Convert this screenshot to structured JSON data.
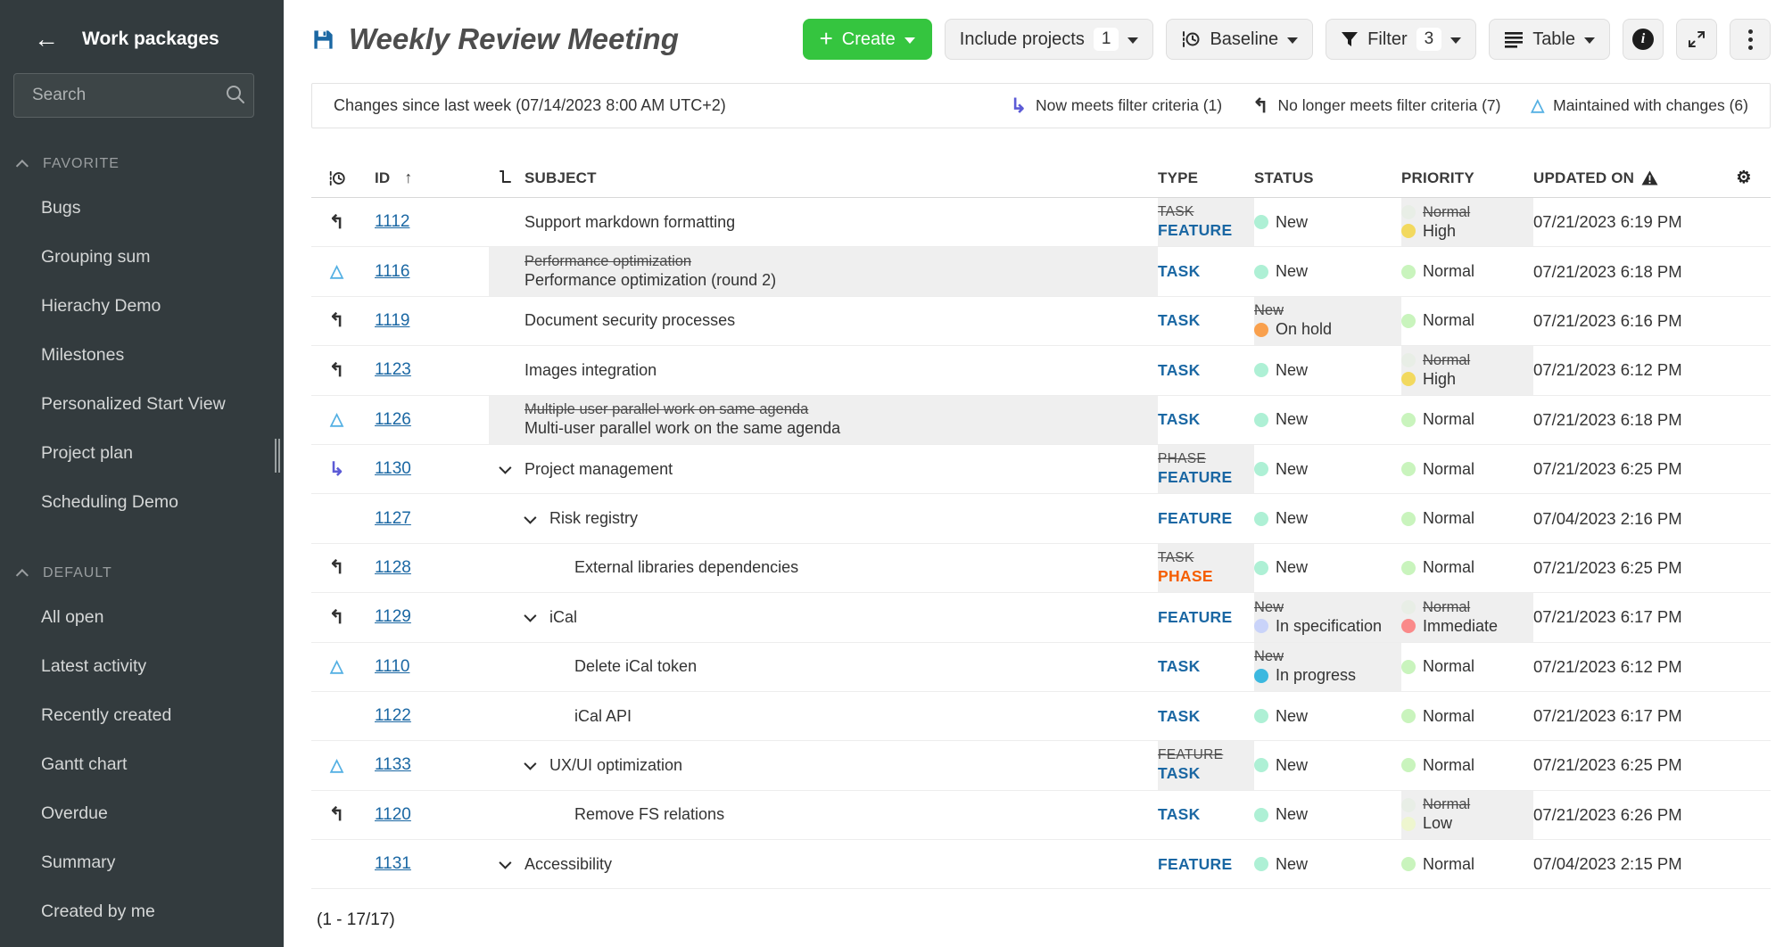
{
  "colors": {
    "accent_green": "#35c53f",
    "link_blue": "#1a67a3",
    "phase_orange": "#f55e00",
    "now_meets_purple": "#5c5bd6",
    "no_longer_meets_dark": "#333333",
    "maintained_blue": "#54b0e3",
    "changed_cell_bg": "#efefef",
    "sidebar_bg": "#333b3e"
  },
  "sidebar": {
    "title": "Work packages",
    "search_placeholder": "Search",
    "sections": [
      {
        "label": "FAVORITE",
        "items": [
          "Bugs",
          "Grouping sum",
          "Hierachy Demo",
          "Milestones",
          "Personalized Start View",
          "Project plan",
          "Scheduling Demo"
        ]
      },
      {
        "label": "DEFAULT",
        "items": [
          "All open",
          "Latest activity",
          "Recently created",
          "Gantt chart",
          "Overdue",
          "Summary",
          "Created by me"
        ]
      }
    ]
  },
  "toolbar": {
    "page_title": "Weekly Review Meeting",
    "create_label": "Create",
    "include_projects_label": "Include projects",
    "include_projects_count": "1",
    "baseline_label": "Baseline",
    "filter_label": "Filter",
    "filter_count": "3",
    "table_label": "Table"
  },
  "changes_bar": {
    "label": "Changes since last week (07/14/2023 8:00 AM UTC+2)",
    "legend": [
      {
        "icon": "now-meets-arrow-icon",
        "label": "Now meets filter criteria (1)",
        "color": "#5c5bd6"
      },
      {
        "icon": "no-longer-meets-arrow-icon",
        "label": "No longer meets filter criteria (7)",
        "color": "#333333"
      },
      {
        "icon": "maintained-triangle-icon",
        "label": "Maintained with changes (6)",
        "color": "#54b0e3"
      }
    ]
  },
  "table": {
    "columns": [
      "ID",
      "SUBJECT",
      "TYPE",
      "STATUS",
      "PRIORITY",
      "UPDATED ON"
    ],
    "rows": [
      {
        "id": "1112",
        "row_icon": "no-longer-meets",
        "indent": 0,
        "chevron": false,
        "subject": {
          "old": null,
          "text": "Support markdown formatting",
          "changed": false
        },
        "type": {
          "old": "TASK",
          "text": "FEATURE",
          "color": "#1a67a3",
          "changed": true
        },
        "status": {
          "old": null,
          "text": "New",
          "dot": "#aef0d5",
          "changed": false
        },
        "priority": {
          "old": "Normal",
          "old_dot": "#c9f4bd",
          "text": "High",
          "dot": "#f2d95f",
          "changed": true
        },
        "updated": "07/21/2023 6:19 PM"
      },
      {
        "id": "1116",
        "row_icon": "maintained",
        "indent": 0,
        "chevron": false,
        "subject": {
          "old": "Performance optimization",
          "text": "Performance optimization (round 2)",
          "changed": true
        },
        "type": {
          "old": null,
          "text": "TASK",
          "color": "#1a67a3",
          "changed": false
        },
        "status": {
          "old": null,
          "text": "New",
          "dot": "#aef0d5",
          "changed": false
        },
        "priority": {
          "old": null,
          "old_dot": null,
          "text": "Normal",
          "dot": "#c9f4bd",
          "changed": false
        },
        "updated": "07/21/2023 6:18 PM"
      },
      {
        "id": "1119",
        "row_icon": "no-longer-meets",
        "indent": 0,
        "chevron": false,
        "subject": {
          "old": null,
          "text": "Document security processes",
          "changed": false
        },
        "type": {
          "old": null,
          "text": "TASK",
          "color": "#1a67a3",
          "changed": false
        },
        "status": {
          "old": "New",
          "text": "On hold",
          "dot": "#f9a04d",
          "changed": true
        },
        "priority": {
          "old": null,
          "old_dot": null,
          "text": "Normal",
          "dot": "#c9f4bd",
          "changed": false
        },
        "updated": "07/21/2023 6:16 PM"
      },
      {
        "id": "1123",
        "row_icon": "no-longer-meets",
        "indent": 0,
        "chevron": false,
        "subject": {
          "old": null,
          "text": "Images integration",
          "changed": false
        },
        "type": {
          "old": null,
          "text": "TASK",
          "color": "#1a67a3",
          "changed": false
        },
        "status": {
          "old": null,
          "text": "New",
          "dot": "#aef0d5",
          "changed": false
        },
        "priority": {
          "old": "Normal",
          "old_dot": "#c9f4bd",
          "text": "High",
          "dot": "#f2d95f",
          "changed": true
        },
        "updated": "07/21/2023 6:12 PM"
      },
      {
        "id": "1126",
        "row_icon": "maintained",
        "indent": 0,
        "chevron": false,
        "subject": {
          "old": "Multiple user parallel work on same agenda",
          "text": "Multi-user parallel work on the same agenda",
          "changed": true
        },
        "type": {
          "old": null,
          "text": "TASK",
          "color": "#1a67a3",
          "changed": false
        },
        "status": {
          "old": null,
          "text": "New",
          "dot": "#aef0d5",
          "changed": false
        },
        "priority": {
          "old": null,
          "old_dot": null,
          "text": "Normal",
          "dot": "#c9f4bd",
          "changed": false
        },
        "updated": "07/21/2023 6:18 PM"
      },
      {
        "id": "1130",
        "row_icon": "now-meets",
        "indent": 0,
        "chevron": true,
        "subject": {
          "old": null,
          "text": "Project management",
          "changed": false
        },
        "type": {
          "old": "PHASE",
          "text": "FEATURE",
          "color": "#1a67a3",
          "changed": true
        },
        "status": {
          "old": null,
          "text": "New",
          "dot": "#aef0d5",
          "changed": false
        },
        "priority": {
          "old": null,
          "old_dot": null,
          "text": "Normal",
          "dot": "#c9f4bd",
          "changed": false
        },
        "updated": "07/21/2023 6:25 PM"
      },
      {
        "id": "1127",
        "row_icon": "none",
        "indent": 1,
        "chevron": true,
        "subject": {
          "old": null,
          "text": "Risk registry",
          "changed": false
        },
        "type": {
          "old": null,
          "text": "FEATURE",
          "color": "#1a67a3",
          "changed": false
        },
        "status": {
          "old": null,
          "text": "New",
          "dot": "#aef0d5",
          "changed": false
        },
        "priority": {
          "old": null,
          "old_dot": null,
          "text": "Normal",
          "dot": "#c9f4bd",
          "changed": false
        },
        "updated": "07/04/2023 2:16 PM"
      },
      {
        "id": "1128",
        "row_icon": "no-longer-meets",
        "indent": 2,
        "chevron": false,
        "subject": {
          "old": null,
          "text": "External libraries dependencies",
          "changed": false
        },
        "type": {
          "old": "TASK",
          "text": "PHASE",
          "color": "#f55e00",
          "changed": true
        },
        "status": {
          "old": null,
          "text": "New",
          "dot": "#aef0d5",
          "changed": false
        },
        "priority": {
          "old": null,
          "old_dot": null,
          "text": "Normal",
          "dot": "#c9f4bd",
          "changed": false
        },
        "updated": "07/21/2023 6:25 PM"
      },
      {
        "id": "1129",
        "row_icon": "no-longer-meets",
        "indent": 1,
        "chevron": true,
        "subject": {
          "old": null,
          "text": "iCal",
          "changed": false
        },
        "type": {
          "old": null,
          "text": "FEATURE",
          "color": "#1a67a3",
          "changed": false
        },
        "status": {
          "old": "New",
          "text": "In specification",
          "dot": "#c9d3f9",
          "changed": true
        },
        "priority": {
          "old": "Normal",
          "old_dot": "#c9f4bd",
          "text": "Immediate",
          "dot": "#fa8a8a",
          "changed": true
        },
        "updated": "07/21/2023 6:17 PM"
      },
      {
        "id": "1110",
        "row_icon": "maintained",
        "indent": 2,
        "chevron": false,
        "subject": {
          "old": null,
          "text": "Delete iCal token",
          "changed": false
        },
        "type": {
          "old": null,
          "text": "TASK",
          "color": "#1a67a3",
          "changed": false
        },
        "status": {
          "old": "New",
          "text": "In progress",
          "dot": "#3cb8df",
          "changed": true
        },
        "priority": {
          "old": null,
          "old_dot": null,
          "text": "Normal",
          "dot": "#c9f4bd",
          "changed": false
        },
        "updated": "07/21/2023 6:12 PM"
      },
      {
        "id": "1122",
        "row_icon": "none",
        "indent": 2,
        "chevron": false,
        "subject": {
          "old": null,
          "text": "iCal API",
          "changed": false
        },
        "type": {
          "old": null,
          "text": "TASK",
          "color": "#1a67a3",
          "changed": false
        },
        "status": {
          "old": null,
          "text": "New",
          "dot": "#aef0d5",
          "changed": false
        },
        "priority": {
          "old": null,
          "old_dot": null,
          "text": "Normal",
          "dot": "#c9f4bd",
          "changed": false
        },
        "updated": "07/21/2023 6:17 PM"
      },
      {
        "id": "1133",
        "row_icon": "maintained",
        "indent": 1,
        "chevron": true,
        "subject": {
          "old": null,
          "text": "UX/UI optimization",
          "changed": false
        },
        "type": {
          "old": "FEATURE",
          "text": "TASK",
          "color": "#1a67a3",
          "changed": true
        },
        "status": {
          "old": null,
          "text": "New",
          "dot": "#aef0d5",
          "changed": false
        },
        "priority": {
          "old": null,
          "old_dot": null,
          "text": "Normal",
          "dot": "#c9f4bd",
          "changed": false
        },
        "updated": "07/21/2023 6:25 PM"
      },
      {
        "id": "1120",
        "row_icon": "no-longer-meets",
        "indent": 2,
        "chevron": false,
        "subject": {
          "old": null,
          "text": "Remove FS relations",
          "changed": false
        },
        "type": {
          "old": null,
          "text": "TASK",
          "color": "#1a67a3",
          "changed": false
        },
        "status": {
          "old": null,
          "text": "New",
          "dot": "#aef0d5",
          "changed": false
        },
        "priority": {
          "old": "Normal",
          "old_dot": "#c9f4bd",
          "text": "Low",
          "dot": "#eef6cf",
          "changed": true
        },
        "updated": "07/21/2023 6:26 PM"
      },
      {
        "id": "1131",
        "row_icon": "none",
        "indent": 0,
        "chevron": true,
        "subject": {
          "old": null,
          "text": "Accessibility",
          "changed": false
        },
        "type": {
          "old": null,
          "text": "FEATURE",
          "color": "#1a67a3",
          "changed": false
        },
        "status": {
          "old": null,
          "text": "New",
          "dot": "#aef0d5",
          "changed": false
        },
        "priority": {
          "old": null,
          "old_dot": null,
          "text": "Normal",
          "dot": "#c9f4bd",
          "changed": false
        },
        "updated": "07/04/2023 2:15 PM"
      }
    ],
    "pagination": "(1 - 17/17)"
  }
}
